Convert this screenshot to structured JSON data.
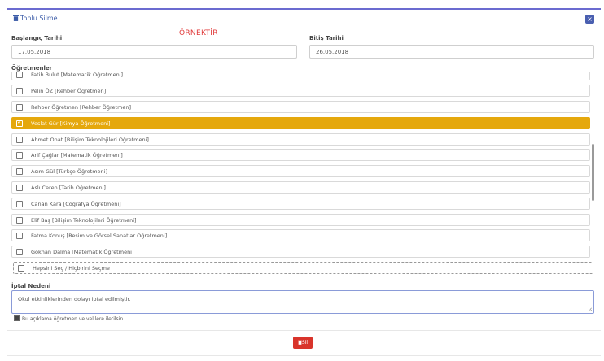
{
  "header": {
    "title": "Toplu Silme",
    "close_label": "×"
  },
  "sample_label": "ÖRNEKTİR",
  "start_date": {
    "label": "Başlangıç Tarihi",
    "value": "17.05.2018"
  },
  "end_date": {
    "label": "Bitiş Tarihi",
    "value": "26.05.2018"
  },
  "teachers": {
    "label": "Öğretmenler",
    "items": [
      {
        "label": "Fatih Bulut [Matematik Öğretmeni]",
        "checked": false
      },
      {
        "label": "Pelin ÖZ [Rehber Öğretmen]",
        "checked": false
      },
      {
        "label": "Rehber Öğretmen [Rehber Öğretmen]",
        "checked": false
      },
      {
        "label": "Veslat Gür [Kimya Öğretmeni]",
        "checked": true
      },
      {
        "label": "Ahmet Onat [Bilişim Teknolojileri Öğretmeni]",
        "checked": false
      },
      {
        "label": "Arif Çağlar [Matematik Öğretmeni]",
        "checked": false
      },
      {
        "label": "Asım Gül [Türkçe Öğretmeni]",
        "checked": false
      },
      {
        "label": "Aslı Ceren [Tarih Öğretmeni]",
        "checked": false
      },
      {
        "label": "Canan Kara [Coğrafya Öğretmeni]",
        "checked": false
      },
      {
        "label": "Elif Baş [Bilişim Teknolojileri Öğretmeni]",
        "checked": false
      },
      {
        "label": "Fatma Konuş [Resim ve Görsel Sanatlar Öğretmeni]",
        "checked": false
      },
      {
        "label": "Gökhan Dalma [Matematik Öğretmeni]",
        "checked": false
      }
    ],
    "select_all_label": "Hepsini Seç / Hiçbirini Seçme"
  },
  "cancel_reason": {
    "label": "İptal Nedeni",
    "value": "Okul etkinliklerinden dolayı iptal edilmiştir."
  },
  "notify_note": "Bu açıklama öğretmen ve velilere iletilsin.",
  "delete_button": "Sil",
  "colors": {
    "accent": "#3c5ca8",
    "selected": "#e5a80c",
    "danger": "#d9342b",
    "sample": "#e03a3a"
  }
}
